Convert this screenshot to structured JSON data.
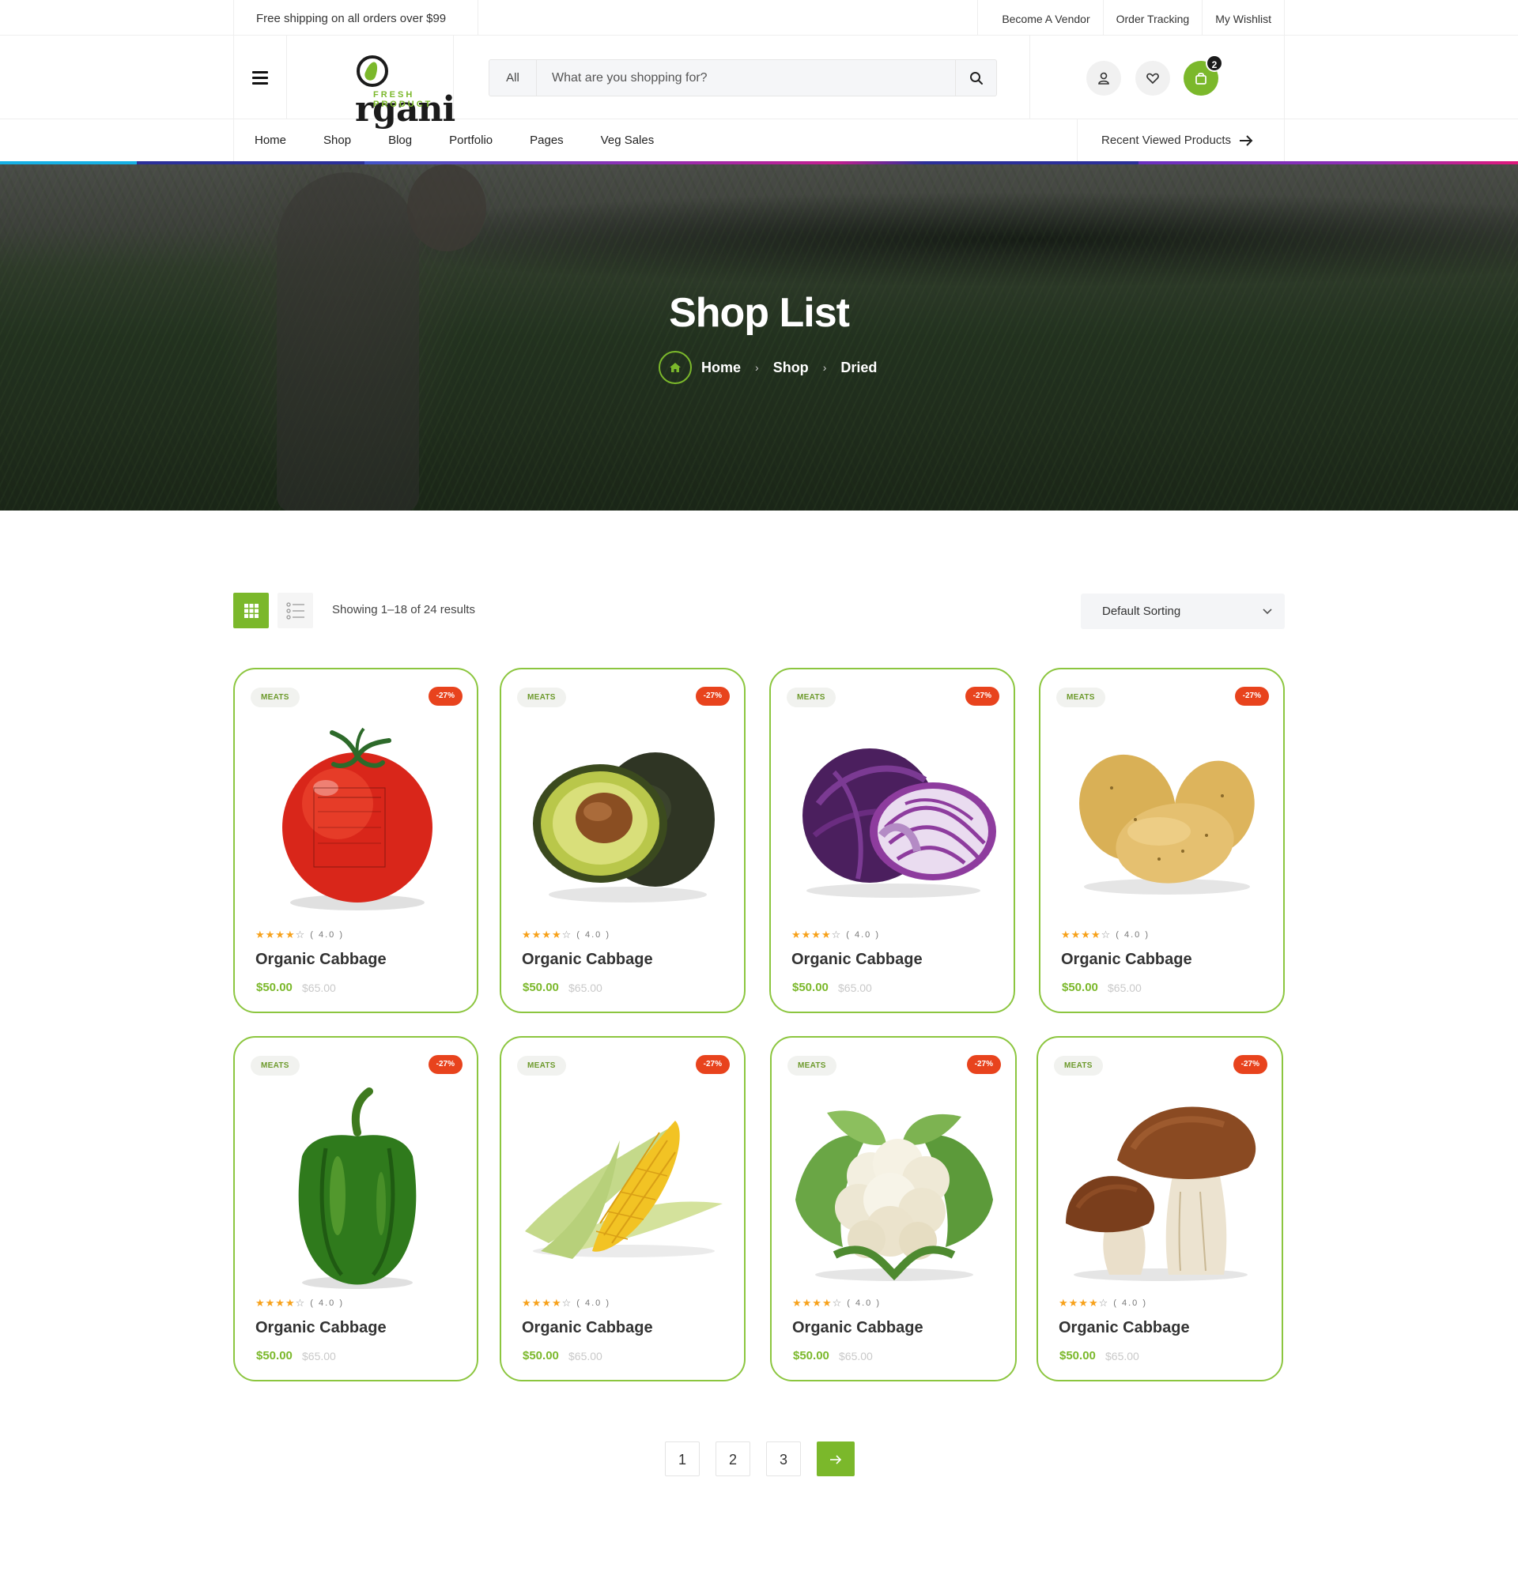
{
  "topbar": {
    "shipping": "Free shipping on all orders over $99",
    "links": [
      "Become A Vendor",
      "Order Tracking",
      "My Wishlist"
    ]
  },
  "header": {
    "logo_word": "rgani",
    "logo_sub": "FRESH PRODUCT",
    "search_category": "All",
    "search_placeholder": "What are you shopping for?",
    "cart_count": "2"
  },
  "nav": {
    "items": [
      "Home",
      "Shop",
      "Blog",
      "Portfolio",
      "Pages",
      "Veg Sales"
    ],
    "recent": "Recent Viewed Products"
  },
  "hero": {
    "title": "Shop List",
    "breadcrumb": [
      "Home",
      "Shop",
      "Dried"
    ]
  },
  "toolbar": {
    "results": "Showing 1–18 of 24 results",
    "sorting": "Default Sorting"
  },
  "products": [
    {
      "category": "MEATS",
      "discount": "-27%",
      "rating": "( 4.0 )",
      "stars": 4,
      "name": "Organic Cabbage",
      "price": "$50.00",
      "old_price": "$65.00",
      "image": "tomato"
    },
    {
      "category": "MEATS",
      "discount": "-27%",
      "rating": "( 4.0 )",
      "stars": 4,
      "name": "Organic Cabbage",
      "price": "$50.00",
      "old_price": "$65.00",
      "image": "avocado"
    },
    {
      "category": "MEATS",
      "discount": "-27%",
      "rating": "( 4.0 )",
      "stars": 4,
      "name": "Organic Cabbage",
      "price": "$50.00",
      "old_price": "$65.00",
      "image": "red-cabbage"
    },
    {
      "category": "MEATS",
      "discount": "-27%",
      "rating": "( 4.0 )",
      "stars": 4,
      "name": "Organic Cabbage",
      "price": "$50.00",
      "old_price": "$65.00",
      "image": "potatoes"
    },
    {
      "category": "MEATS",
      "discount": "-27%",
      "rating": "( 4.0 )",
      "stars": 4,
      "name": "Organic Cabbage",
      "price": "$50.00",
      "old_price": "$65.00",
      "image": "green-pepper"
    },
    {
      "category": "MEATS",
      "discount": "-27%",
      "rating": "( 4.0 )",
      "stars": 4,
      "name": "Organic Cabbage",
      "price": "$50.00",
      "old_price": "$65.00",
      "image": "corn"
    },
    {
      "category": "MEATS",
      "discount": "-27%",
      "rating": "( 4.0 )",
      "stars": 4,
      "name": "Organic Cabbage",
      "price": "$50.00",
      "old_price": "$65.00",
      "image": "cauliflower"
    },
    {
      "category": "MEATS",
      "discount": "-27%",
      "rating": "( 4.0 )",
      "stars": 4,
      "name": "Organic Cabbage",
      "price": "$50.00",
      "old_price": "$65.00",
      "image": "mushrooms"
    }
  ],
  "pagination": {
    "pages": [
      "1",
      "2",
      "3"
    ],
    "next": "→"
  },
  "colors": {
    "accent": "#7bb82b",
    "discount": "#e8431d",
    "star": "#f7a11a"
  }
}
